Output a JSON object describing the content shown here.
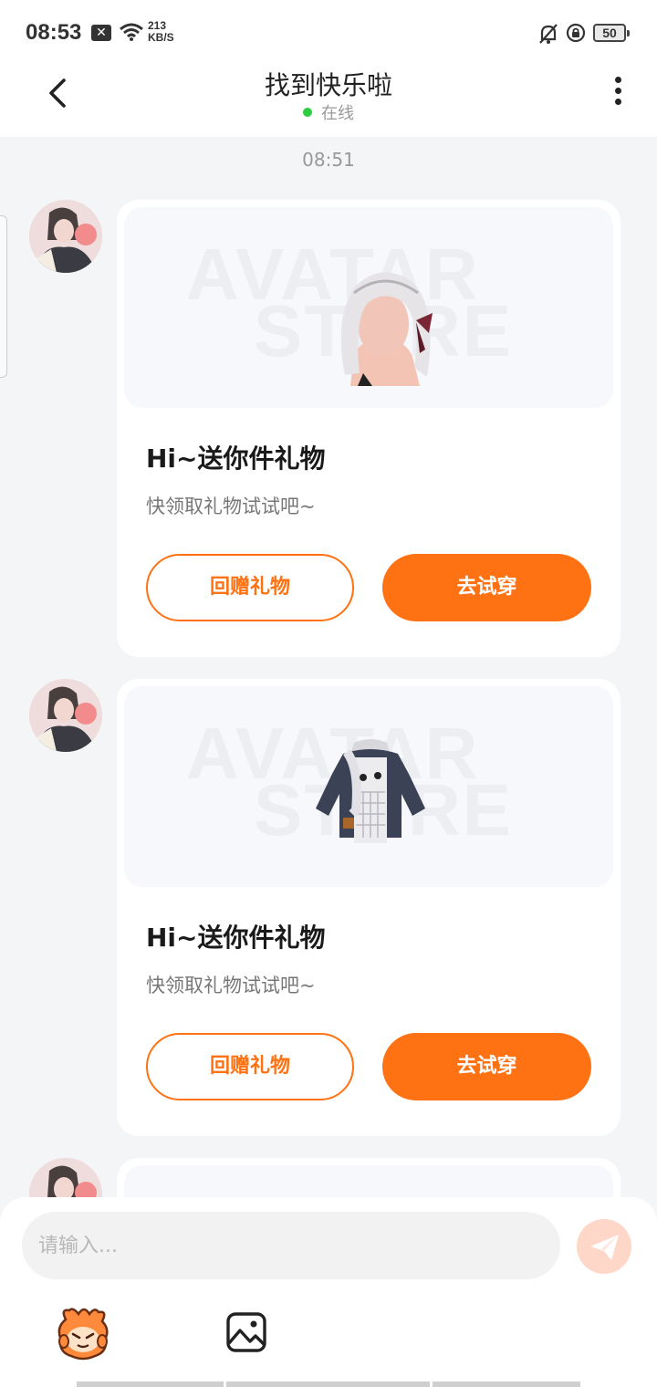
{
  "status_bar": {
    "time": "08:53",
    "notif": "✕",
    "speed_value": "213",
    "speed_unit": "KB/S",
    "battery": "50"
  },
  "header": {
    "title": "找到快乐啦",
    "status": "在线"
  },
  "chat": {
    "timestamp": "08:51",
    "watermark_line1": "AVATAR",
    "watermark_line2": "STORE",
    "messages": [
      {
        "title": "Hi~送你件礼物",
        "subtitle": "快领取礼物试试吧~",
        "gift_icon": "hair-icon",
        "return_label": "回赠礼物",
        "try_label": "去试穿"
      },
      {
        "title": "Hi~送你件礼物",
        "subtitle": "快领取礼物试试吧~",
        "gift_icon": "jacket-icon",
        "return_label": "回赠礼物",
        "try_label": "去试穿"
      }
    ]
  },
  "composer": {
    "placeholder": "请输入...",
    "send_icon": "send-icon",
    "emoji_icon": "emoji-icon",
    "image_icon": "image-icon"
  },
  "colors": {
    "accent": "#ff7214",
    "online": "#2ecc40",
    "background": "#f4f5f7"
  }
}
